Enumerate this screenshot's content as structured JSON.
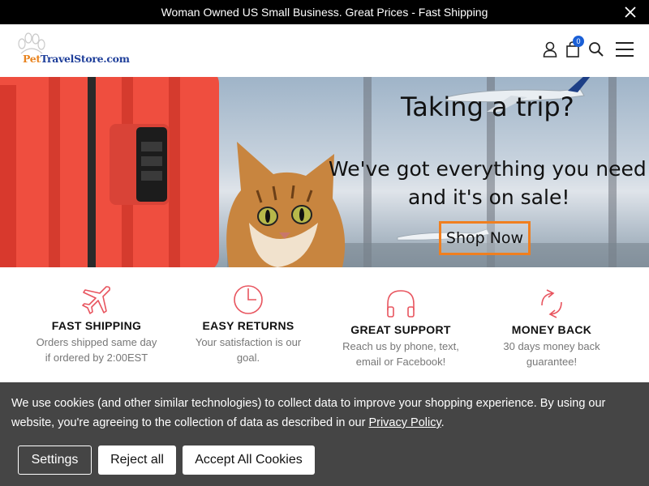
{
  "announcement": {
    "text": "Woman Owned US Small Business. Great Prices - Fast Shipping"
  },
  "header": {
    "logo_text_part1": "Pet",
    "logo_text_part2": "TravelStore.com",
    "cart_count": "0",
    "icons": [
      "account-icon",
      "cart-icon",
      "search-icon",
      "menu-icon"
    ]
  },
  "hero": {
    "headline": "Taking a trip?",
    "subline1": "We've got everything you need -",
    "subline2": "and it's on sale!",
    "cta_label": "Shop Now",
    "accent_color": "#f07f1f"
  },
  "features": [
    {
      "icon": "airplane-icon",
      "title": "FAST SHIPPING",
      "line1": "Orders shipped same day",
      "line2": "if ordered by 2:00EST"
    },
    {
      "icon": "clock-icon",
      "title": "EASY RETURNS",
      "line1": "Your satisfaction is our",
      "line2": "goal."
    },
    {
      "icon": "headphones-icon",
      "title": "GREAT SUPPORT",
      "line1": "Reach us by phone, text,",
      "line2": "email or Facebook!"
    },
    {
      "icon": "refresh-icon",
      "title": "MONEY BACK",
      "line1": "30 days money back",
      "line2": "guarantee!"
    }
  ],
  "cookie_banner": {
    "text_before_link": "We use cookies (and other similar technologies) to collect data to improve your shopping experience. By using our website, you're agreeing to the collection of data as described in our ",
    "link_text": "Privacy Policy",
    "text_after_link": ".",
    "settings_label": "Settings",
    "reject_label": "Reject all",
    "accept_label": "Accept All Cookies"
  },
  "colors": {
    "icon_accent": "#e8555f",
    "cart_badge": "#1a5fd6",
    "cookie_background": "#454545"
  }
}
